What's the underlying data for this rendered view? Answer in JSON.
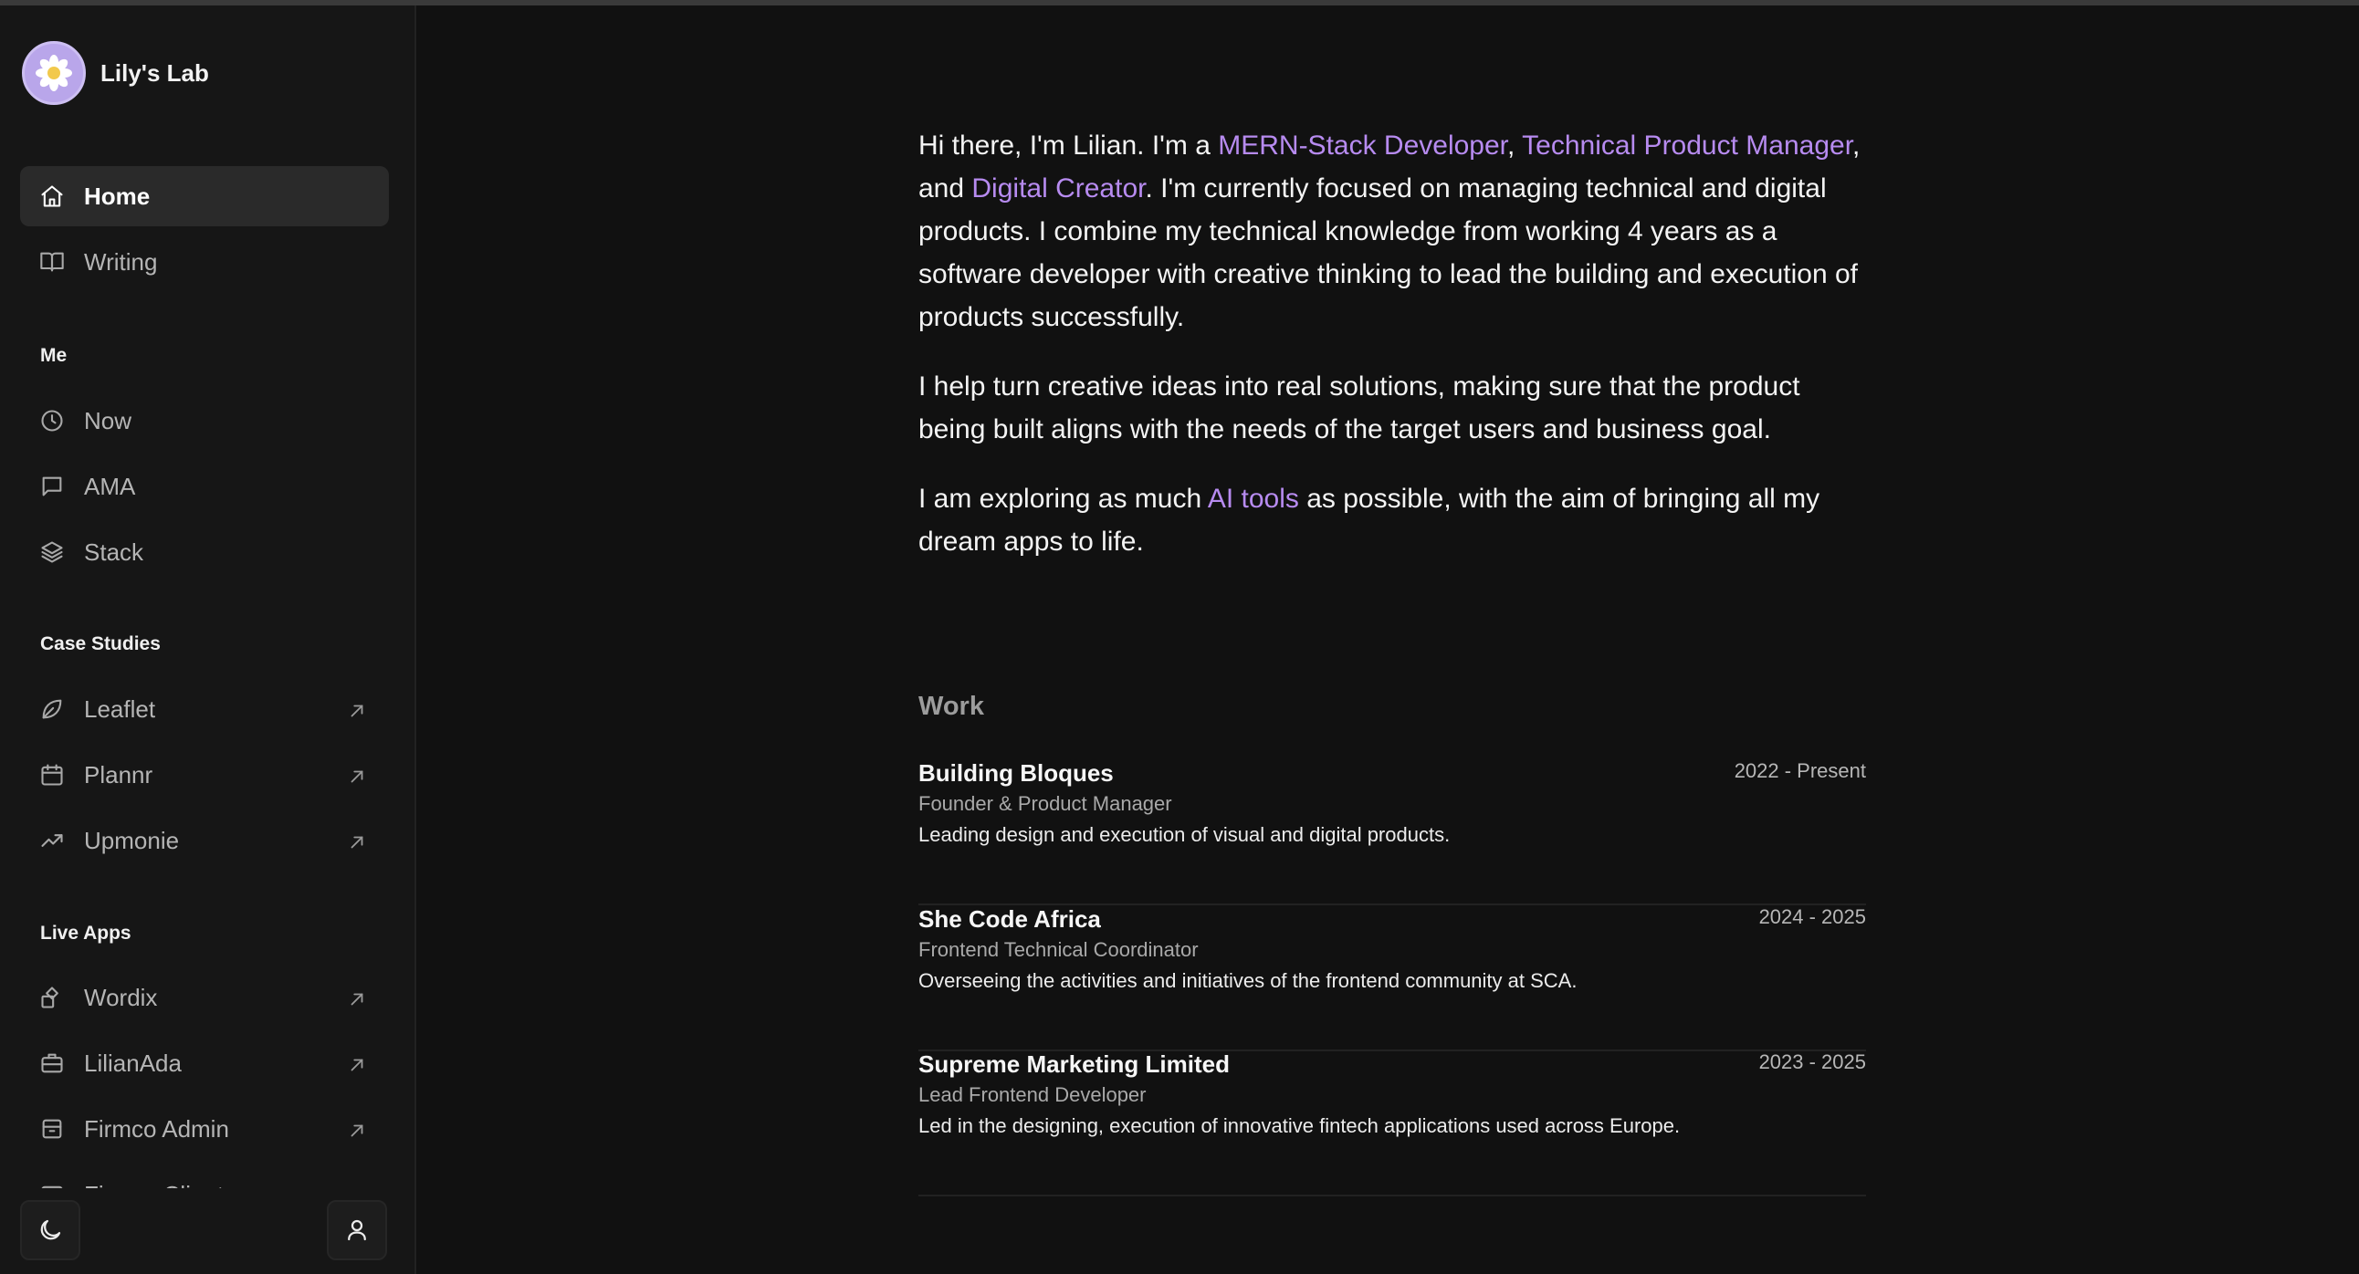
{
  "brand": {
    "name": "Lily's Lab"
  },
  "nav": {
    "primary": [
      {
        "label": "Home",
        "icon": "home-icon",
        "active": true
      },
      {
        "label": "Writing",
        "icon": "book-icon"
      }
    ],
    "me_title": "Me",
    "me": [
      {
        "label": "Now",
        "icon": "clock-icon"
      },
      {
        "label": "AMA",
        "icon": "message-icon"
      },
      {
        "label": "Stack",
        "icon": "layers-icon"
      }
    ],
    "case_studies_title": "Case Studies",
    "case_studies": [
      {
        "label": "Leaflet",
        "icon": "leaf-icon"
      },
      {
        "label": "Plannr",
        "icon": "calendar-icon"
      },
      {
        "label": "Upmonie",
        "icon": "trending-up-icon"
      }
    ],
    "live_apps_title": "Live Apps",
    "live_apps": [
      {
        "label": "Wordix",
        "icon": "shapes-icon"
      },
      {
        "label": "LilianAda",
        "icon": "briefcase-icon"
      },
      {
        "label": "Firmco Admin",
        "icon": "archive-icon"
      },
      {
        "label": "Firmco Client",
        "icon": "card-icon"
      }
    ]
  },
  "bottom": {
    "theme_icon": "moon-icon",
    "profile_icon": "user-icon"
  },
  "intro": {
    "p1_a": "Hi there, I'm Lilian. I'm a ",
    "p1_link1": "MERN-Stack Developer",
    "p1_b": ", ",
    "p1_link2": "Technical Product Manager",
    "p1_c": ", and ",
    "p1_link3": "Digital Creator",
    "p1_d": ". I'm currently focused on managing technical and digital products. I combine my technical knowledge from working 4 years as a software developer with creative thinking to lead the building and execution of products successfully.",
    "p2": "I help turn creative ideas into real solutions, making sure that the product being built aligns with the needs of the target users and business goal.",
    "p3_a": "I am exploring as much ",
    "p3_link": "AI tools",
    "p3_b": " as possible, with the aim of bringing all my dream apps to life."
  },
  "work": {
    "title": "Work",
    "jobs": [
      {
        "company": "Building Bloques",
        "years": "2022 - Present",
        "role": "Founder & Product Manager",
        "desc": "Leading design and execution of visual and digital products."
      },
      {
        "company": "She Code Africa",
        "years": "2024 - 2025",
        "role": "Frontend Technical Coordinator",
        "desc": "Overseeing the activities and initiatives of the frontend community at SCA."
      },
      {
        "company": "Supreme Marketing Limited",
        "years": "2023 - 2025",
        "role": "Lead Frontend Developer",
        "desc": "Led in the designing, execution of innovative fintech applications used across Europe."
      }
    ]
  },
  "colors": {
    "accent": "#b78bf0",
    "background": "#111111",
    "sidebar": "#161616"
  }
}
